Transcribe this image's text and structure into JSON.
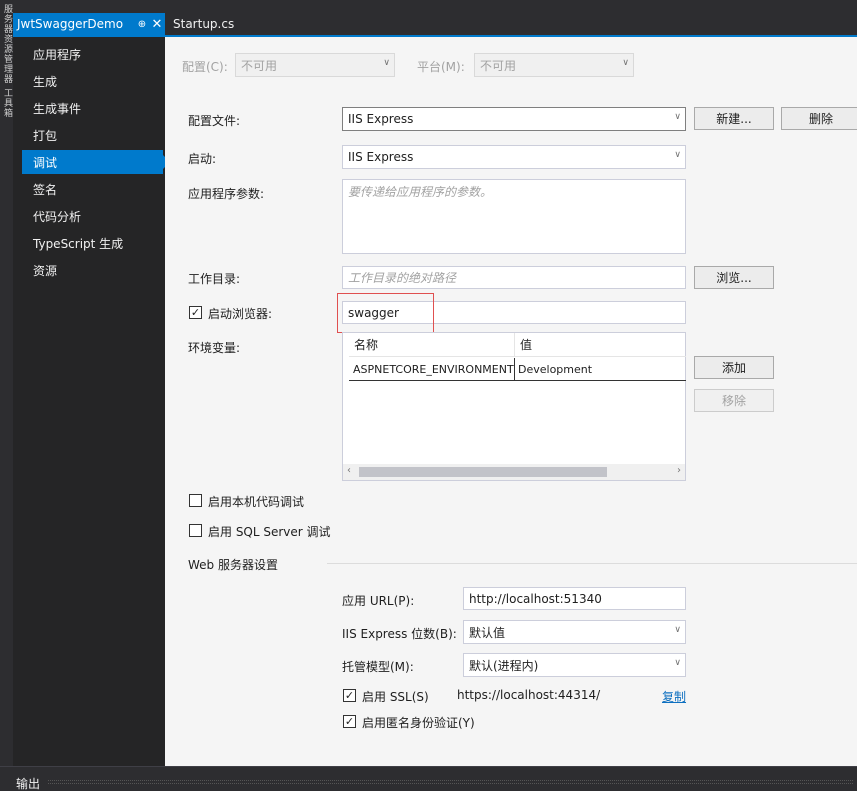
{
  "left_strip": {
    "text": "服务器资源管理器 工具箱"
  },
  "tabs": [
    {
      "label": "JwtSwaggerDemo",
      "pin": "⊕",
      "close": "✕"
    },
    {
      "label": "Startup.cs"
    }
  ],
  "nav": {
    "items": [
      {
        "label": "应用程序"
      },
      {
        "label": "生成"
      },
      {
        "label": "生成事件"
      },
      {
        "label": "打包"
      },
      {
        "label": "调试"
      },
      {
        "label": "签名"
      },
      {
        "label": "代码分析"
      },
      {
        "label": "TypeScript 生成"
      },
      {
        "label": "资源"
      }
    ],
    "active": "调试"
  },
  "config": {
    "config_label": "配置(C):",
    "config_value": "不可用",
    "platform_label": "平台(M):",
    "platform_value": "不可用"
  },
  "profile": {
    "label": "配置文件:",
    "value": "IIS Express",
    "new_button": "新建...",
    "delete_button": "删除"
  },
  "launch": {
    "label": "启动:",
    "value": "IIS Express"
  },
  "app_args": {
    "label": "应用程序参数:",
    "placeholder": "要传递给应用程序的参数。"
  },
  "working_dir": {
    "label": "工作目录:",
    "placeholder": "工作目录的绝对路径",
    "browse_button": "浏览..."
  },
  "launch_browser": {
    "label": "启动浏览器:",
    "checked": true,
    "value": "swagger"
  },
  "env_vars": {
    "label": "环境变量:",
    "columns": [
      "名称",
      "值"
    ],
    "rows": [
      {
        "name": "ASPNETCORE_ENVIRONMENT",
        "value": "Development"
      }
    ],
    "add_button": "添加",
    "remove_button": "移除"
  },
  "native_debug": {
    "label": "启用本机代码调试",
    "checked": false
  },
  "sql_debug": {
    "label": "启用 SQL Server 调试",
    "checked": false
  },
  "web_server": {
    "section_label": "Web 服务器设置",
    "app_url_label": "应用 URL(P):",
    "app_url_value": "http://localhost:51340",
    "bitness_label": "IIS Express 位数(B):",
    "bitness_value": "默认值",
    "hosting_label": "托管模型(M):",
    "hosting_value": "默认(进程内)",
    "ssl_label": "启用 SSL(S)",
    "ssl_checked": true,
    "ssl_url": "https://localhost:44314/",
    "copy_link": "复制",
    "anon_auth_label": "启用匿名身份验证(Y)",
    "anon_auth_checked": true
  },
  "bottom": {
    "output_label": "输出"
  },
  "colors": {
    "accent": "#007acc",
    "dark_bg": "#2d2d30",
    "nav_bg": "#252526",
    "content_bg": "#f5f5f5",
    "highlight": "#e05050",
    "link": "#0e70c0"
  }
}
